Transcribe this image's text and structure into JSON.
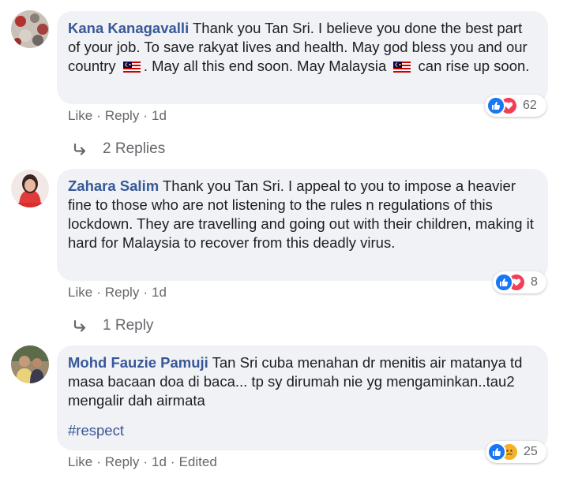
{
  "comments": [
    {
      "author": "Kana Kanagavalli",
      "text_1": " Thank you Tan Sri. I believe you done the best part of your job. To save rakyat lives and health. May god bless you and our country ",
      "text_2": ". May all this end soon. May Malaysia ",
      "text_3": " can rise up soon.",
      "reaction_count": "62",
      "reactions": [
        "like-icon",
        "love-icon"
      ],
      "actions": {
        "like": "Like",
        "reply": "Reply",
        "time": "1d"
      },
      "replies_label": "2 Replies"
    },
    {
      "author": "Zahara Salim",
      "text_1": " Thank you Tan Sri. I appeal to you to impose a heavier fine to those who are not listening to the rules n regulations of this lockdown. They are travelling and going out with their children, making it hard for Malaysia to recover from this deadly virus.",
      "reaction_count": "8",
      "reactions": [
        "like-icon",
        "love-icon"
      ],
      "actions": {
        "like": "Like",
        "reply": "Reply",
        "time": "1d"
      },
      "replies_label": "1 Reply"
    },
    {
      "author": "Mohd Fauzie Pamuji",
      "text_1": " Tan Sri cuba menahan dr menitis air matanya td masa bacaan doa di baca... tp sy dirumah nie yg mengaminkan..tau2 mengalir dah airmata",
      "hashtag": "#respect",
      "reaction_count": "25",
      "reactions": [
        "like-icon",
        "sad-icon"
      ],
      "actions": {
        "like": "Like",
        "reply": "Reply",
        "time": "1d",
        "edited": "Edited"
      }
    }
  ],
  "colors": {
    "link": "#385898",
    "bubble": "#f0f2f5",
    "meta": "#65676b",
    "like": "#1877f2",
    "love": "#f33e58",
    "sad": "#f7b125"
  }
}
